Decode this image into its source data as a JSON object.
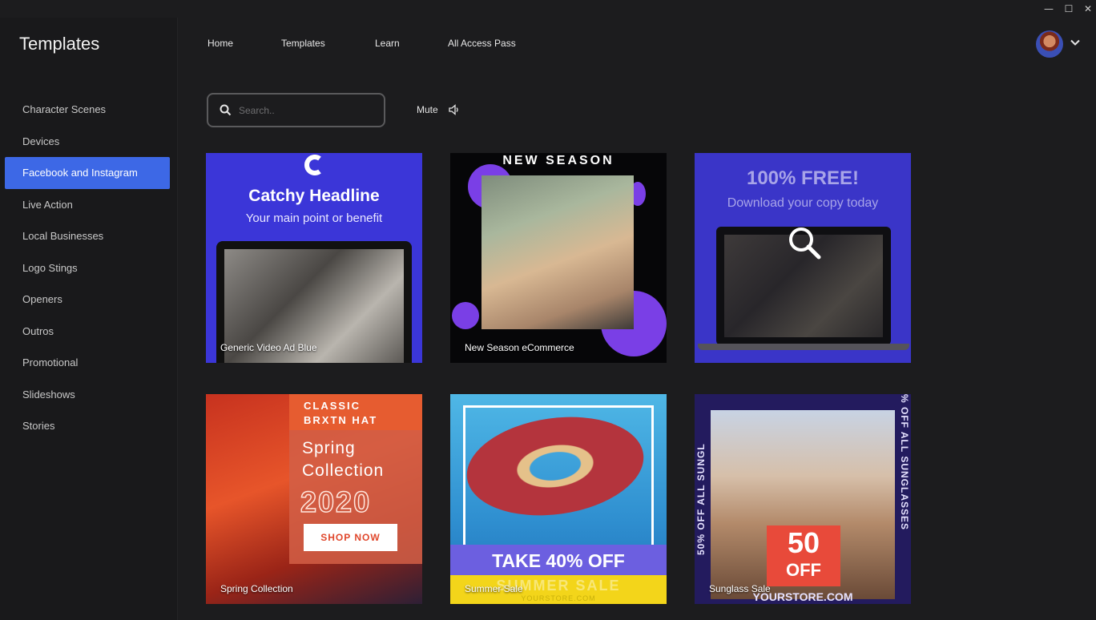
{
  "window": {
    "minimize": "—",
    "maximize": "☐",
    "close": "✕"
  },
  "sidebar": {
    "title": "Templates",
    "items": [
      {
        "label": "Character Scenes",
        "active": false
      },
      {
        "label": "Devices",
        "active": false
      },
      {
        "label": "Facebook and Instagram",
        "active": true
      },
      {
        "label": "Live Action",
        "active": false
      },
      {
        "label": "Local Businesses",
        "active": false
      },
      {
        "label": "Logo Stings",
        "active": false
      },
      {
        "label": "Openers",
        "active": false
      },
      {
        "label": "Outros",
        "active": false
      },
      {
        "label": "Promotional",
        "active": false
      },
      {
        "label": "Slideshows",
        "active": false
      },
      {
        "label": "Stories",
        "active": false
      }
    ]
  },
  "topnav": {
    "home": "Home",
    "templates": "Templates",
    "learn": "Learn",
    "all_access": "All Access Pass"
  },
  "search": {
    "placeholder": "Search..",
    "value": ""
  },
  "mute": {
    "label": "Mute",
    "icon": "speaker-icon"
  },
  "colors": {
    "accent": "#3d68e6",
    "background": "#1c1c1e",
    "sidebar": "#19191b"
  },
  "templates": [
    {
      "name": "Generic Video Ad Blue",
      "headline": "Catchy Headline",
      "subline": "Your main point or benefit"
    },
    {
      "name": "New Season eCommerce",
      "headline": "NEW SEASON"
    },
    {
      "name": "",
      "headline": "100% FREE!",
      "subline": "Download your copy today"
    },
    {
      "name": "Spring Collection",
      "tag": "CLASSIC\nBRXTN HAT",
      "headline": "Spring\nCollection",
      "year": "2020",
      "cta": "SHOP NOW"
    },
    {
      "name": "Summer Sale",
      "headline": "TAKE 40% OFF",
      "subline": "SUMMER SALE",
      "footer": "YOURSTORE.COM"
    },
    {
      "name": "Sunglass Sale",
      "side_left": "50% OFF ALL SUNGL",
      "side_right": "% OFF ALL SUNGLASSES",
      "badge_num": "50",
      "badge_text": "OFF",
      "footer": "YOURSTORE.COM"
    }
  ]
}
